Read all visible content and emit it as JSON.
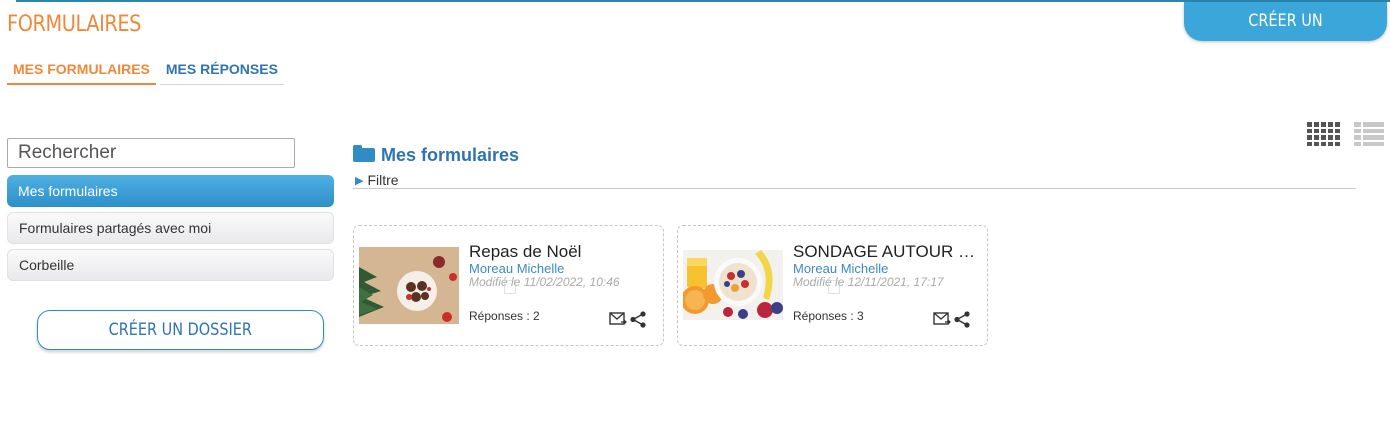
{
  "header": {
    "title": "FORMULAIRES",
    "create_form_label": "CRÉER UN FORMULAIRE"
  },
  "tabs": [
    {
      "label": "MES FORMULAIRES",
      "active": true
    },
    {
      "label": "MES RÉPONSES",
      "active": false
    }
  ],
  "view_toggle": {
    "grid_icon": "grid-view-icon",
    "list_icon": "list-view-icon",
    "selected": "grid"
  },
  "sidebar": {
    "search_placeholder": "Rechercher",
    "items": [
      {
        "label": "Mes formulaires",
        "active": true
      },
      {
        "label": "Formulaires partagés avec moi",
        "active": false
      },
      {
        "label": "Corbeille",
        "active": false
      }
    ],
    "create_folder_label": "CRÉER UN DOSSIER"
  },
  "main": {
    "heading": "Mes formulaires",
    "filter_label": "Filtre",
    "cards": [
      {
        "title": "Repas de Noël",
        "author": "Moreau Michelle",
        "modified": "Modifié le 11/02/2022, 10:46",
        "responses": "Réponses : 2"
      },
      {
        "title": "SONDAGE AUTOUR DU PETIT DÉJEUNER",
        "author": "Moreau Michelle",
        "modified": "Modifié le 12/11/2021, 17:17",
        "responses": "Réponses : 3"
      }
    ]
  },
  "colors": {
    "accent_orange": "#f0883a",
    "accent_blue": "#2f8cc4",
    "link_blue": "#2f74b1"
  }
}
